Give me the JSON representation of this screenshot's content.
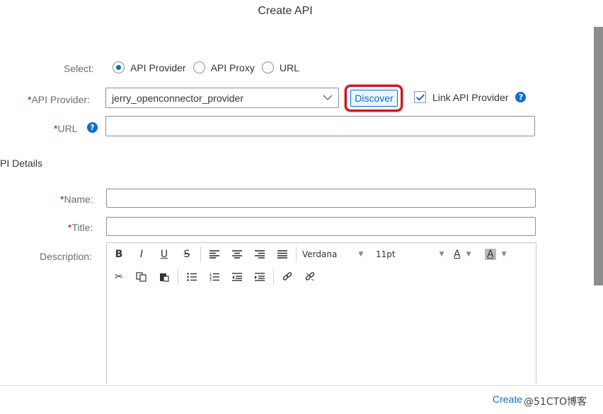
{
  "dialog": {
    "title": "Create API"
  },
  "select": {
    "label": "Select:",
    "options": [
      {
        "label": "API Provider",
        "selected": true
      },
      {
        "label": "API Proxy",
        "selected": false
      },
      {
        "label": "URL",
        "selected": false
      }
    ]
  },
  "api_provider": {
    "required_mark": "*",
    "label": "API Provider:",
    "value": "jerry_openconnector_provider",
    "discover_label": "Discover",
    "link_label": "Link API Provider",
    "link_checked": true,
    "help_icon": "?"
  },
  "url_field": {
    "required_mark": "*",
    "label": "URL",
    "value": "",
    "help_icon": "?"
  },
  "section": {
    "title": "PI Details"
  },
  "name_field": {
    "required_mark": "*",
    "label": "Name:",
    "value": ""
  },
  "title_field": {
    "required_mark": "*",
    "label": "Title:",
    "value": ""
  },
  "description": {
    "label": "Description:",
    "toolbar": {
      "bold": "B",
      "italic": "I",
      "underline": "U",
      "strike": "S",
      "font": "Verdana",
      "size": "11pt",
      "text_color": "A",
      "bg_color": "A"
    }
  },
  "footer": {
    "create_label": "Create"
  },
  "watermark": "@51CTO博客",
  "colors": {
    "accent": "#0a6ed1",
    "required": "#bb0000",
    "highlight": "#d0121b"
  }
}
